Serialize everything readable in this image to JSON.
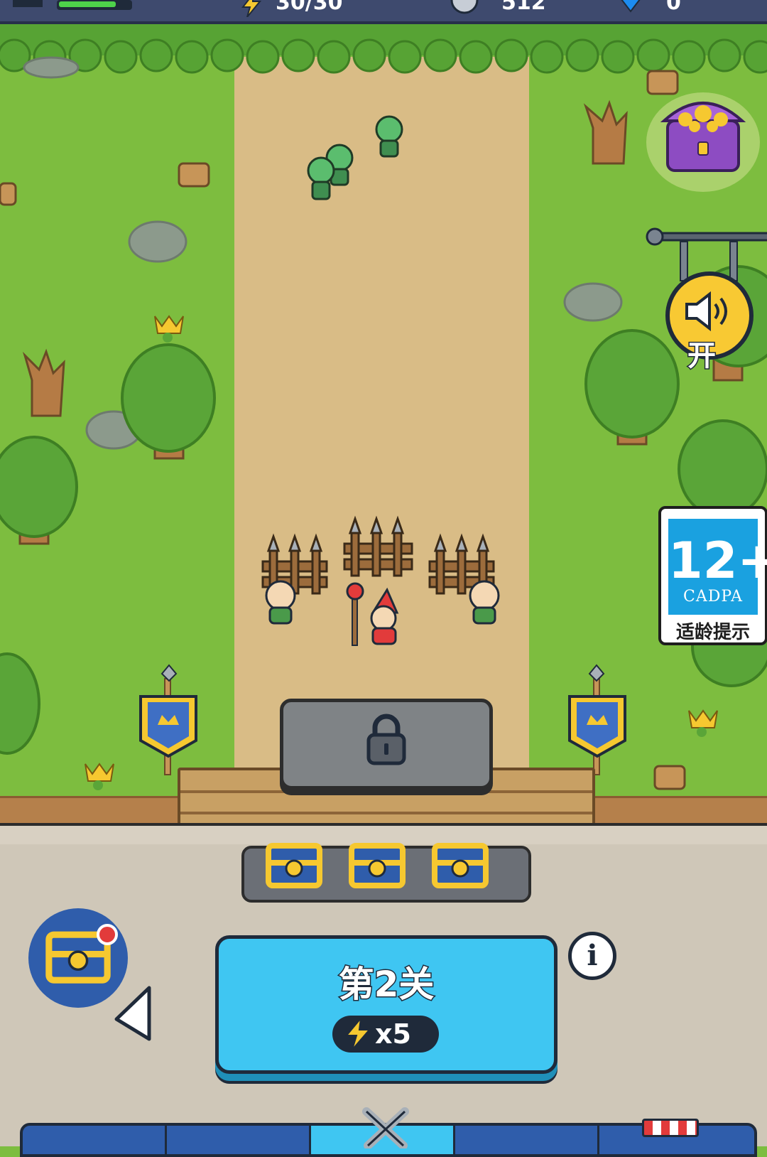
{
  "top_bar": {
    "energy_value": "30/30",
    "coin_value": "512",
    "gem_value": "0"
  },
  "side": {
    "sound_label": "开"
  },
  "age_rating": {
    "rating": "12+",
    "org": "CADPA",
    "hint": "适龄提示"
  },
  "level": {
    "title": "第2关",
    "energy_cost": "x5"
  },
  "info_label": "i",
  "colors": {
    "grass": "#7dbd3f",
    "road": "#d9bc86",
    "button_blue": "#3fc6f2",
    "dark_outline": "#1f2a3a"
  },
  "bottom_nav": {
    "tabs": [
      "upgrade-tab",
      "blank-tab",
      "battle-tab",
      "hero-tab",
      "shop-tab"
    ],
    "active_index": 2
  }
}
